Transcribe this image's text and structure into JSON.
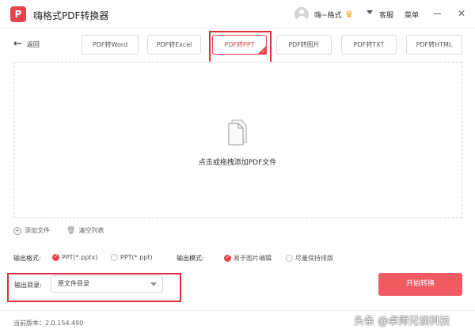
{
  "app": {
    "title": "嗨格式PDF转换器",
    "logo_text": "P"
  },
  "header": {
    "username": "嗨~格式",
    "crown_icon": "crown-icon",
    "service_label": "客服",
    "menu_label": "菜单",
    "close_glyph": "✕"
  },
  "nav": {
    "back_label": "返回",
    "back_glyph": "🡐"
  },
  "tabs": [
    {
      "label": "PDF转Word",
      "active": false
    },
    {
      "label": "PDF转Excel",
      "active": false
    },
    {
      "label": "PDF转PPT",
      "active": true
    },
    {
      "label": "PDF转图片",
      "active": false
    },
    {
      "label": "PDF转TXT",
      "active": false
    },
    {
      "label": "PDF转HTML",
      "active": false
    }
  ],
  "dropzone": {
    "hint": "点击或拖拽添加PDF文件"
  },
  "actions": {
    "add_file": "添加文件",
    "clear_list": "清空列表"
  },
  "output_format": {
    "label": "输出格式:",
    "options": [
      "PPT(*.pptx)",
      "PPT(*.ppt)"
    ],
    "selected": "PPT(*.pptx)"
  },
  "output_mode": {
    "label": "输出模式:",
    "options": [
      "易于图片编辑",
      "尽量保持排版"
    ],
    "selected": "易于图片编辑"
  },
  "output_dir": {
    "label": "输出目录:",
    "value": "原文件目录"
  },
  "start_button": "开始转换",
  "version": "当前版本：2.0.154.490",
  "watermark": "头条 @卓师兄谈科技",
  "colors": {
    "accent": "#e8424b",
    "button": "#ef5a63",
    "highlight": "#d9303a"
  }
}
